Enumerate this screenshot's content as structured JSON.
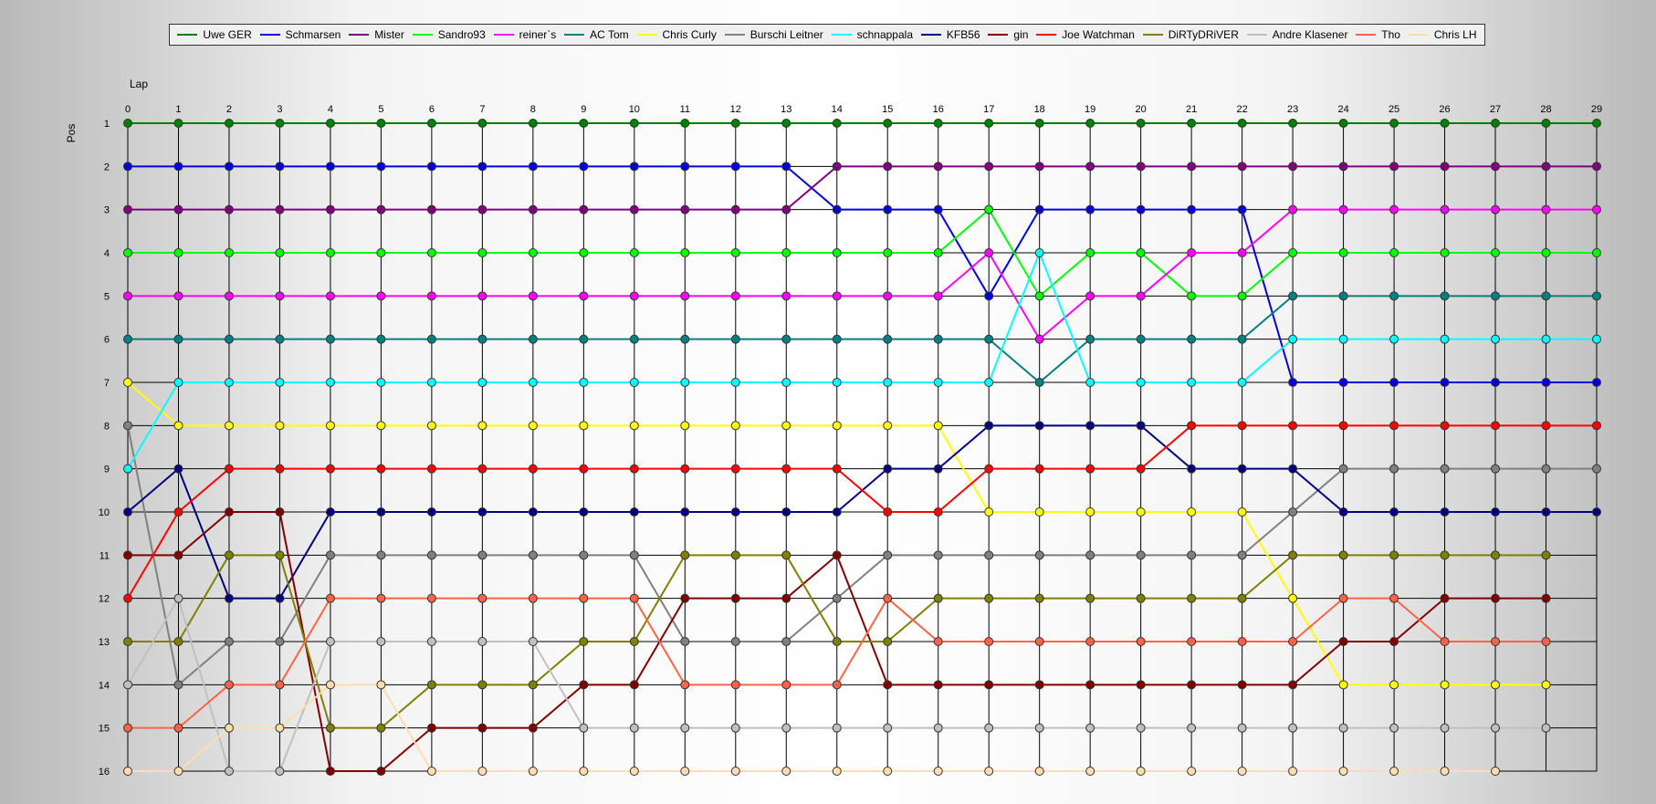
{
  "chart_data": {
    "type": "line",
    "xlabel": "Lap",
    "ylabel": "Pos",
    "x": [
      0,
      1,
      2,
      3,
      4,
      5,
      6,
      7,
      8,
      9,
      10,
      11,
      12,
      13,
      14,
      15,
      16,
      17,
      18,
      19,
      20,
      21,
      22,
      23,
      24,
      25,
      26,
      27,
      28,
      29
    ],
    "xlim": [
      0,
      29
    ],
    "ylim": [
      1,
      16
    ],
    "y_inverted": true,
    "grid": true,
    "legend_position": "top",
    "series": [
      {
        "name": "Uwe GER",
        "color": "#008000",
        "values": [
          1,
          1,
          1,
          1,
          1,
          1,
          1,
          1,
          1,
          1,
          1,
          1,
          1,
          1,
          1,
          1,
          1,
          1,
          1,
          1,
          1,
          1,
          1,
          1,
          1,
          1,
          1,
          1,
          1,
          1
        ]
      },
      {
        "name": "Schmarsen",
        "color": "#0000e0",
        "values": [
          2,
          2,
          2,
          2,
          2,
          2,
          2,
          2,
          2,
          2,
          2,
          2,
          2,
          2,
          3,
          3,
          3,
          5,
          3,
          3,
          3,
          3,
          3,
          7,
          7,
          7,
          7,
          7,
          7,
          7
        ]
      },
      {
        "name": "Mister",
        "color": "#800080",
        "values": [
          3,
          3,
          3,
          3,
          3,
          3,
          3,
          3,
          3,
          3,
          3,
          3,
          3,
          3,
          2,
          2,
          2,
          2,
          2,
          2,
          2,
          2,
          2,
          2,
          2,
          2,
          2,
          2,
          2,
          2
        ]
      },
      {
        "name": "Sandro93",
        "color": "#00ff00",
        "values": [
          4,
          4,
          4,
          4,
          4,
          4,
          4,
          4,
          4,
          4,
          4,
          4,
          4,
          4,
          4,
          4,
          4,
          3,
          5,
          4,
          4,
          5,
          5,
          4,
          4,
          4,
          4,
          4,
          4,
          4
        ]
      },
      {
        "name": "reiner`s",
        "color": "#ff00ff",
        "values": [
          5,
          5,
          5,
          5,
          5,
          5,
          5,
          5,
          5,
          5,
          5,
          5,
          5,
          5,
          5,
          5,
          5,
          4,
          6,
          5,
          5,
          4,
          4,
          3,
          3,
          3,
          3,
          3,
          3,
          3
        ]
      },
      {
        "name": "AC Tom",
        "color": "#008080",
        "values": [
          6,
          6,
          6,
          6,
          6,
          6,
          6,
          6,
          6,
          6,
          6,
          6,
          6,
          6,
          6,
          6,
          6,
          6,
          7,
          6,
          6,
          6,
          6,
          5,
          5,
          5,
          5,
          5,
          5,
          5
        ]
      },
      {
        "name": "Chris Curly",
        "color": "#ffff00",
        "values": [
          7,
          8,
          8,
          8,
          8,
          8,
          8,
          8,
          8,
          8,
          8,
          8,
          8,
          8,
          8,
          8,
          8,
          10,
          10,
          10,
          10,
          10,
          10,
          12,
          14,
          14,
          14,
          14,
          14,
          null
        ]
      },
      {
        "name": "Burschi Leitner",
        "color": "#808080",
        "values": [
          8,
          14,
          13,
          13,
          11,
          11,
          11,
          11,
          11,
          11,
          11,
          13,
          13,
          13,
          12,
          11,
          11,
          11,
          11,
          11,
          11,
          11,
          11,
          10,
          9,
          9,
          9,
          9,
          9,
          9
        ]
      },
      {
        "name": "schnappala",
        "color": "#00ffff",
        "values": [
          9,
          7,
          7,
          7,
          7,
          7,
          7,
          7,
          7,
          7,
          7,
          7,
          7,
          7,
          7,
          7,
          7,
          7,
          4,
          7,
          7,
          7,
          7,
          6,
          6,
          6,
          6,
          6,
          6,
          6
        ]
      },
      {
        "name": "KFB56",
        "color": "#000080",
        "values": [
          10,
          9,
          12,
          12,
          10,
          10,
          10,
          10,
          10,
          10,
          10,
          10,
          10,
          10,
          10,
          9,
          9,
          8,
          8,
          8,
          8,
          9,
          9,
          9,
          10,
          10,
          10,
          10,
          10,
          10
        ]
      },
      {
        "name": "gin",
        "color": "#800000",
        "values": [
          11,
          11,
          10,
          10,
          16,
          16,
          15,
          15,
          15,
          14,
          14,
          12,
          12,
          12,
          11,
          14,
          14,
          14,
          14,
          14,
          14,
          14,
          14,
          14,
          13,
          13,
          12,
          12,
          12,
          null
        ]
      },
      {
        "name": "Joe Watchman",
        "color": "#ff0000",
        "values": [
          12,
          10,
          9,
          9,
          9,
          9,
          9,
          9,
          9,
          9,
          9,
          9,
          9,
          9,
          9,
          10,
          10,
          9,
          9,
          9,
          9,
          8,
          8,
          8,
          8,
          8,
          8,
          8,
          8,
          8
        ]
      },
      {
        "name": "DiRTyDRiVER",
        "color": "#808000",
        "values": [
          13,
          13,
          11,
          11,
          15,
          15,
          14,
          14,
          14,
          13,
          13,
          11,
          11,
          11,
          13,
          13,
          12,
          12,
          12,
          12,
          12,
          12,
          12,
          11,
          11,
          11,
          11,
          11,
          11,
          null
        ]
      },
      {
        "name": "Andre Klasener",
        "color": "#c0c0c0",
        "values": [
          14,
          12,
          16,
          16,
          13,
          13,
          13,
          13,
          13,
          15,
          15,
          15,
          15,
          15,
          15,
          15,
          15,
          15,
          15,
          15,
          15,
          15,
          15,
          15,
          15,
          15,
          15,
          15,
          15,
          null
        ]
      },
      {
        "name": "Tho",
        "color": "#ff6347",
        "values": [
          15,
          15,
          14,
          14,
          12,
          12,
          12,
          12,
          12,
          12,
          12,
          14,
          14,
          14,
          14,
          12,
          13,
          13,
          13,
          13,
          13,
          13,
          13,
          13,
          12,
          12,
          13,
          13,
          13,
          null
        ]
      },
      {
        "name": "Chris LH",
        "color": "#ffdead",
        "values": [
          16,
          16,
          15,
          15,
          14,
          14,
          16,
          16,
          16,
          16,
          16,
          16,
          16,
          16,
          16,
          16,
          16,
          16,
          16,
          16,
          16,
          16,
          16,
          16,
          16,
          16,
          16,
          16,
          null,
          null
        ]
      }
    ]
  }
}
